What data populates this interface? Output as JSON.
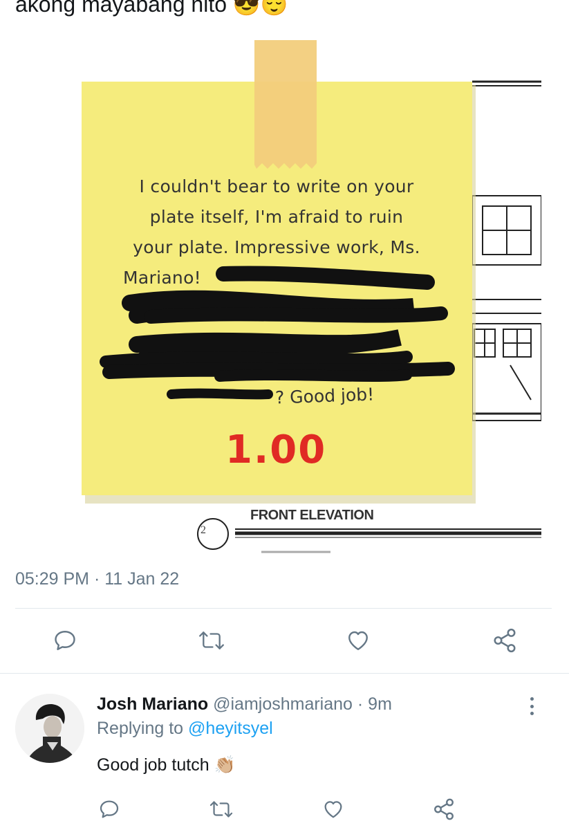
{
  "tweet": {
    "text": "akong mayabang nito 😎😌",
    "timestamp": "05:29 PM · 11 Jan 22"
  },
  "media": {
    "note_lines": [
      "I couldn't bear to write on your",
      "plate itself, I'm afraid to ruin",
      "your plate. Impressive work, Ms.",
      "Mariano!"
    ],
    "note_closing": "? Good job!",
    "grade": "1.00",
    "drawing_label": "FRONT ELEVATION",
    "drawing_number": "2"
  },
  "actions": {
    "reply_icon": "reply-icon",
    "retweet_icon": "retweet-icon",
    "like_icon": "heart-icon",
    "share_icon": "share-icon"
  },
  "reply": {
    "name": "Josh Mariano",
    "handle": "@iamjoshmariano · 9m",
    "replying_prefix": "Replying to ",
    "replying_mention": "@heyitsyel",
    "body": "Good job tutch 👏🏼"
  },
  "colors": {
    "note": "#f5ec7d",
    "tape": "#f2cd7c",
    "grade": "#e02a24",
    "secondary_text": "#657786",
    "link": "#1da1f2"
  }
}
